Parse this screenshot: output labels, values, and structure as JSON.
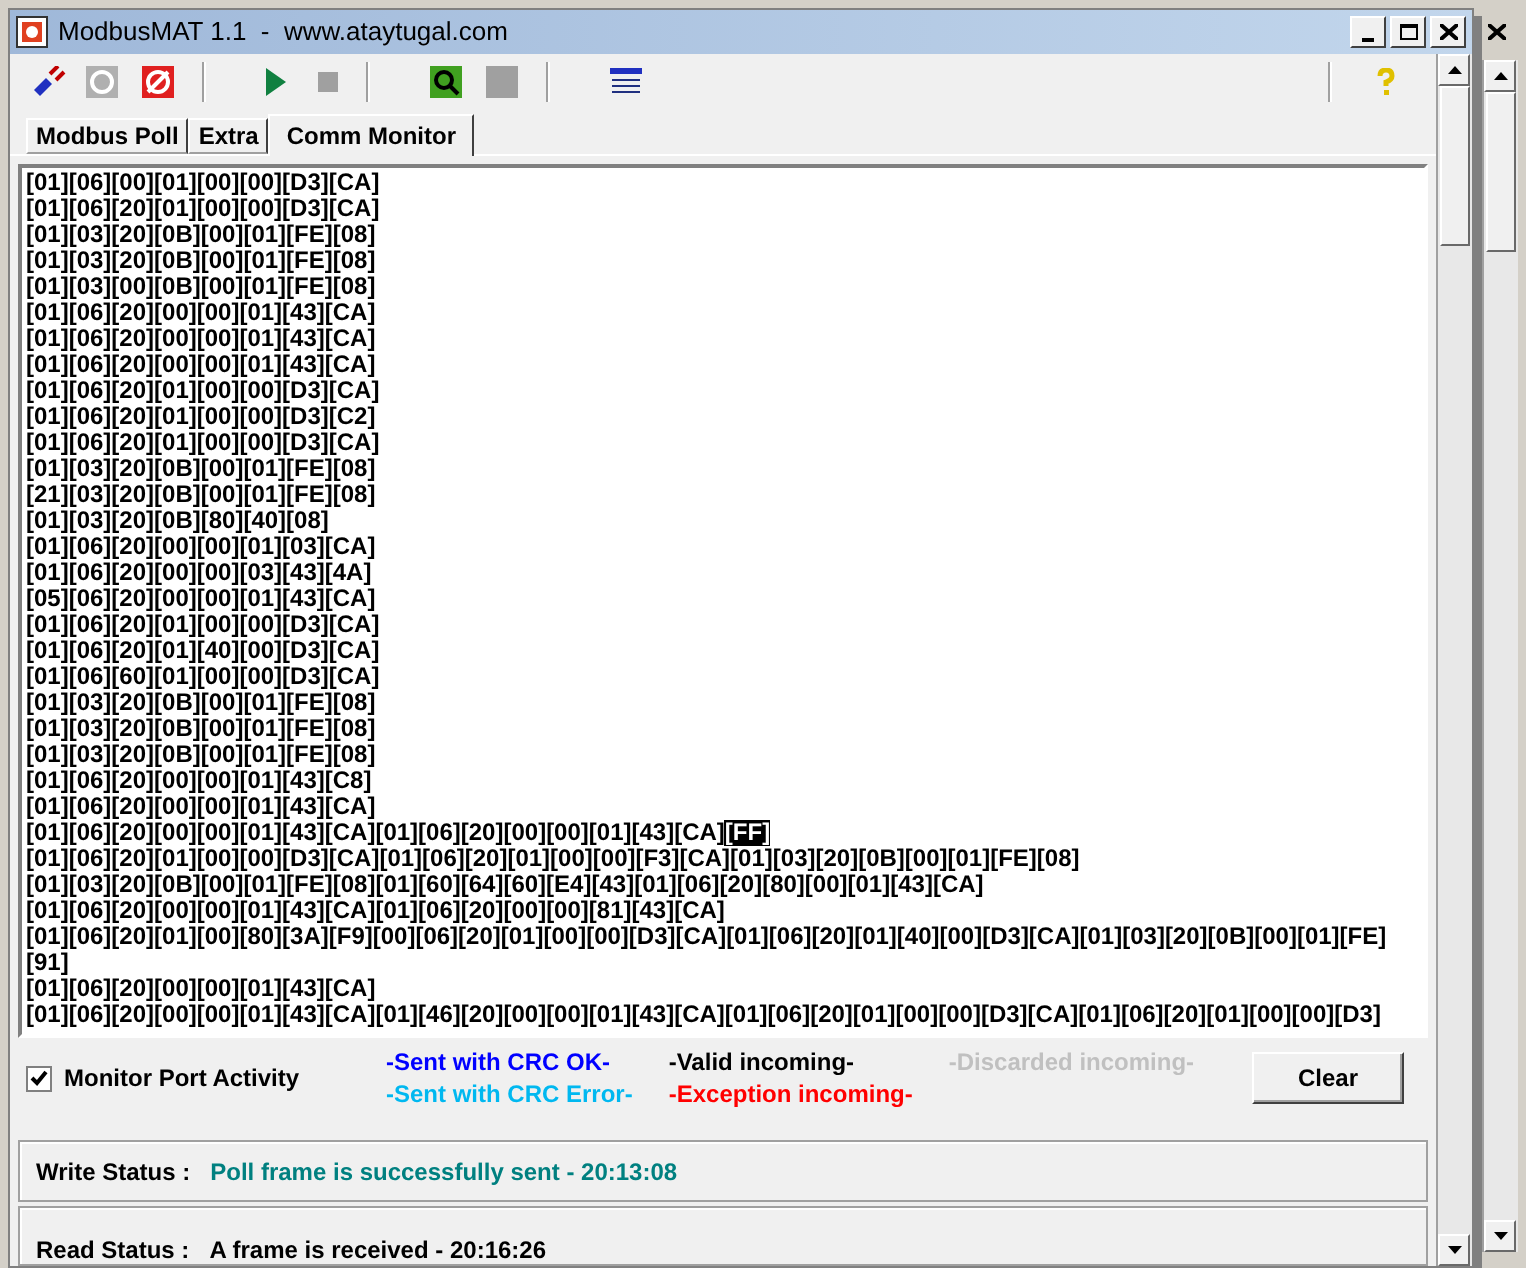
{
  "window": {
    "title": "ModbusMAT 1.1  -  www.ataytugal.com"
  },
  "tabs": [
    {
      "label": "Modbus Poll",
      "selected": false
    },
    {
      "label": "Extra",
      "selected": false
    },
    {
      "label": "Comm Monitor",
      "selected": true
    }
  ],
  "monitor": {
    "lines": [
      [
        {
          "text": "[01][06][00][01][00][00][D3][CA]",
          "highlighted": false
        }
      ],
      [
        {
          "text": "[01][06][20][01][00][00][D3][CA]",
          "highlighted": false
        }
      ],
      [
        {
          "text": "[01][03][20][0B][00][01][FE][08]",
          "highlighted": false
        }
      ],
      [
        {
          "text": "[01][03][20][0B][00][01][FE][08]",
          "highlighted": false
        }
      ],
      [
        {
          "text": "[01][03][00][0B][00][01][FE][08]",
          "highlighted": false
        }
      ],
      [
        {
          "text": "[01][06][20][00][00][01][43][CA]",
          "highlighted": false
        }
      ],
      [
        {
          "text": "[01][06][20][00][00][01][43][CA]",
          "highlighted": false
        }
      ],
      [
        {
          "text": "[01][06][20][00][00][01][43][CA]",
          "highlighted": false
        }
      ],
      [
        {
          "text": "[01][06][20][01][00][00][D3][CA]",
          "highlighted": false
        }
      ],
      [
        {
          "text": "[01][06][20][01][00][00][D3][C2]",
          "highlighted": false
        }
      ],
      [
        {
          "text": "[01][06][20][01][00][00][D3][CA]",
          "highlighted": false
        }
      ],
      [
        {
          "text": "[01][03][20][0B][00][01][FE][08]",
          "highlighted": false
        }
      ],
      [
        {
          "text": "[21][03][20][0B][00][01][FE][08]",
          "highlighted": false
        }
      ],
      [
        {
          "text": "[01][03][20][0B][80][40][08]",
          "highlighted": false
        }
      ],
      [
        {
          "text": "[01][06][20][00][00][01][03][CA]",
          "highlighted": false
        }
      ],
      [
        {
          "text": "[01][06][20][00][00][03][43][4A]",
          "highlighted": false
        }
      ],
      [
        {
          "text": "[05][06][20][00][00][01][43][CA]",
          "highlighted": false
        }
      ],
      [
        {
          "text": "[01][06][20][01][00][00][D3][CA]",
          "highlighted": false
        }
      ],
      [
        {
          "text": "[01][06][20][01][40][00][D3][CA]",
          "highlighted": false
        }
      ],
      [
        {
          "text": "[01][06][60][01][00][00][D3][CA]",
          "highlighted": false
        }
      ],
      [
        {
          "text": "[01][03][20][0B][00][01][FE][08]",
          "highlighted": false
        }
      ],
      [
        {
          "text": "[01][03][20][0B][00][01][FE][08]",
          "highlighted": false
        }
      ],
      [
        {
          "text": "[01][03][20][0B][00][01][FE][08]",
          "highlighted": false
        }
      ],
      [
        {
          "text": "[01][06][20][00][00][01][43][C8]",
          "highlighted": false
        }
      ],
      [
        {
          "text": "[01][06][20][00][00][01][43][CA]",
          "highlighted": false
        }
      ],
      [
        {
          "text": "[01][06][20][00][00][01][43][CA][01][06][20][00][00][01][43][CA]",
          "highlighted": false
        },
        {
          "text": "[FF]",
          "highlighted": true
        }
      ],
      [
        {
          "text": "[01][06][20][01][00][00][D3][CA][01][06][20][01][00][00][F3][CA][01][03][20][0B][00][01][FE][08]",
          "highlighted": false
        }
      ],
      [
        {
          "text": "[01][03][20][0B][00][01][FE][08][01][60][64][60][E4][43][01][06][20][80][00][01][43][CA]",
          "highlighted": false
        }
      ],
      [
        {
          "text": "[01][06][20][00][00][01][43][CA][01][06][20][00][00][81][43][CA]",
          "highlighted": false
        }
      ],
      [
        {
          "text": "[01][06][20][01][00][80][3A][F9][00][06][20][01][00][00][D3][CA][01][06][20][01][40][00][D3][CA][01][03][20][0B][00][01][FE]",
          "highlighted": false
        }
      ],
      [
        {
          "text": "[91]",
          "highlighted": false
        }
      ],
      [
        {
          "text": "[01][06][20][00][00][01][43][CA]",
          "highlighted": false
        }
      ],
      [
        {
          "text": "[01][06][20][00][00][01][43][CA][01][46][20][00][00][01][43][CA][01][06][20][01][00][00][D3][CA][01][06][20][01][00][00][D3]",
          "highlighted": false
        }
      ]
    ]
  },
  "monitor_port_activity": {
    "label": "Monitor Port Activity",
    "checked": true
  },
  "legend": [
    {
      "label": "-Sent with CRC OK-",
      "color": "#0000ff"
    },
    {
      "label": "-Sent with CRC Error-",
      "color": "#00b8f0"
    },
    {
      "label": "-Valid incoming-",
      "color": "#000000"
    },
    {
      "label": "-Exception incoming-",
      "color": "#ff0000"
    },
    {
      "label": "-Discarded incoming-",
      "color": "#c0c0c0"
    }
  ],
  "clear_button": {
    "label": "Clear"
  },
  "write_status": {
    "label": "Write Status :",
    "value": "Poll frame is successfully sent - 20:13:08"
  },
  "read_status": {
    "label": "Read Status :",
    "value": "A frame is received - 20:16:26"
  }
}
